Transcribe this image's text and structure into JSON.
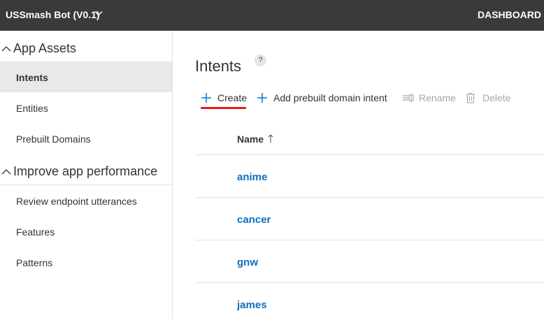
{
  "topbar": {
    "app_title": "USSmash Bot (V0.1)",
    "dashboard": "DASHBOARD"
  },
  "sidebar": {
    "sections": [
      {
        "label": "App Assets",
        "items": [
          "Intents",
          "Entities",
          "Prebuilt Domains"
        ]
      },
      {
        "label": "Improve app performance",
        "items": [
          "Review endpoint utterances",
          "Features",
          "Patterns"
        ]
      }
    ],
    "active_item": "Intents"
  },
  "main": {
    "title": "Intents",
    "help": "?",
    "toolbar": {
      "create": "Create",
      "add_prebuilt": "Add prebuilt domain intent",
      "rename": "Rename",
      "delete": "Delete"
    },
    "table": {
      "column_name": "Name",
      "sort": "ascending",
      "rows": [
        "anime",
        "cancer",
        "gnw",
        "james"
      ]
    }
  },
  "colors": {
    "topbar": "#3a3a3a",
    "link": "#106ebe",
    "accent": "#0078d4",
    "highlight_underline": "#e31b1b"
  }
}
